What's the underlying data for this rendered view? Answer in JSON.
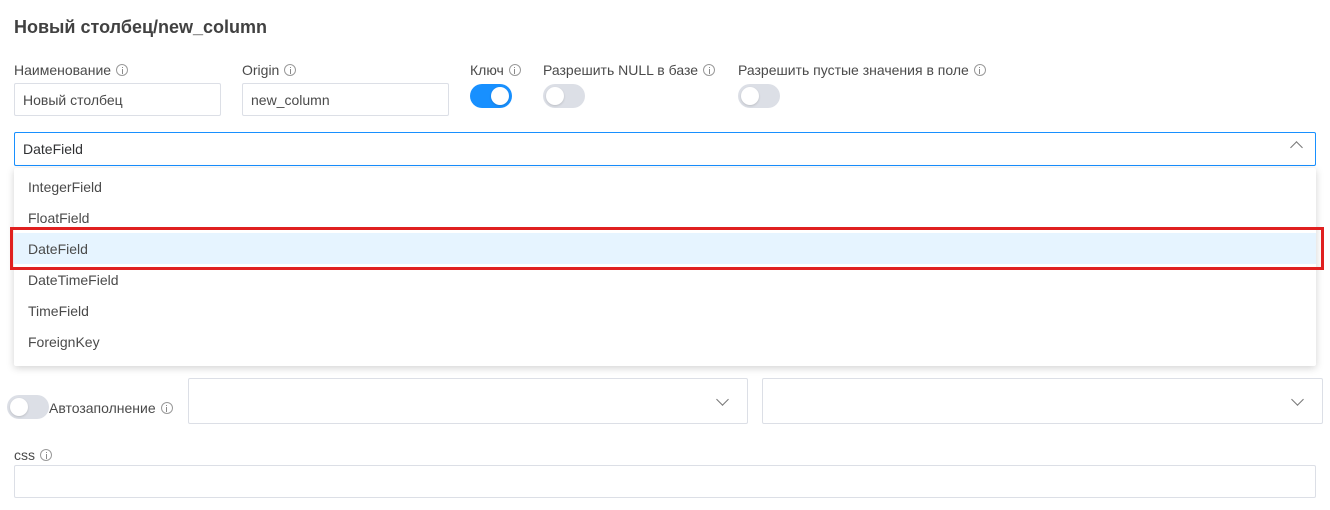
{
  "form": {
    "title": "Новый столбец/new_column",
    "name_label": "Наименование",
    "name_value": "Новый столбец",
    "origin_label": "Origin",
    "origin_value": "new_column",
    "key_label": "Ключ",
    "key_on": true,
    "allow_null_label": "Разрешить NULL в базе",
    "allow_null_on": false,
    "allow_empty_label": "Разрешить пустые значения в поле",
    "allow_empty_on": false,
    "type_selected": "DateField",
    "autofill_label": "Автозаполнение",
    "autofill_on": false,
    "css_label": "css",
    "css_value": ""
  },
  "type_options": [
    {
      "label": "IntegerField",
      "selected": false
    },
    {
      "label": "FloatField",
      "selected": false
    },
    {
      "label": "DateField",
      "selected": true
    },
    {
      "label": "DateTimeField",
      "selected": false
    },
    {
      "label": "TimeField",
      "selected": false
    },
    {
      "label": "ForeignKey",
      "selected": false
    }
  ],
  "icons": {
    "info": "info-icon",
    "dropdown": "chevron-down-icon"
  },
  "colors": {
    "accent": "#1890ff",
    "selected_option_bg": "#e6f4ff",
    "highlight": "#e02020"
  }
}
